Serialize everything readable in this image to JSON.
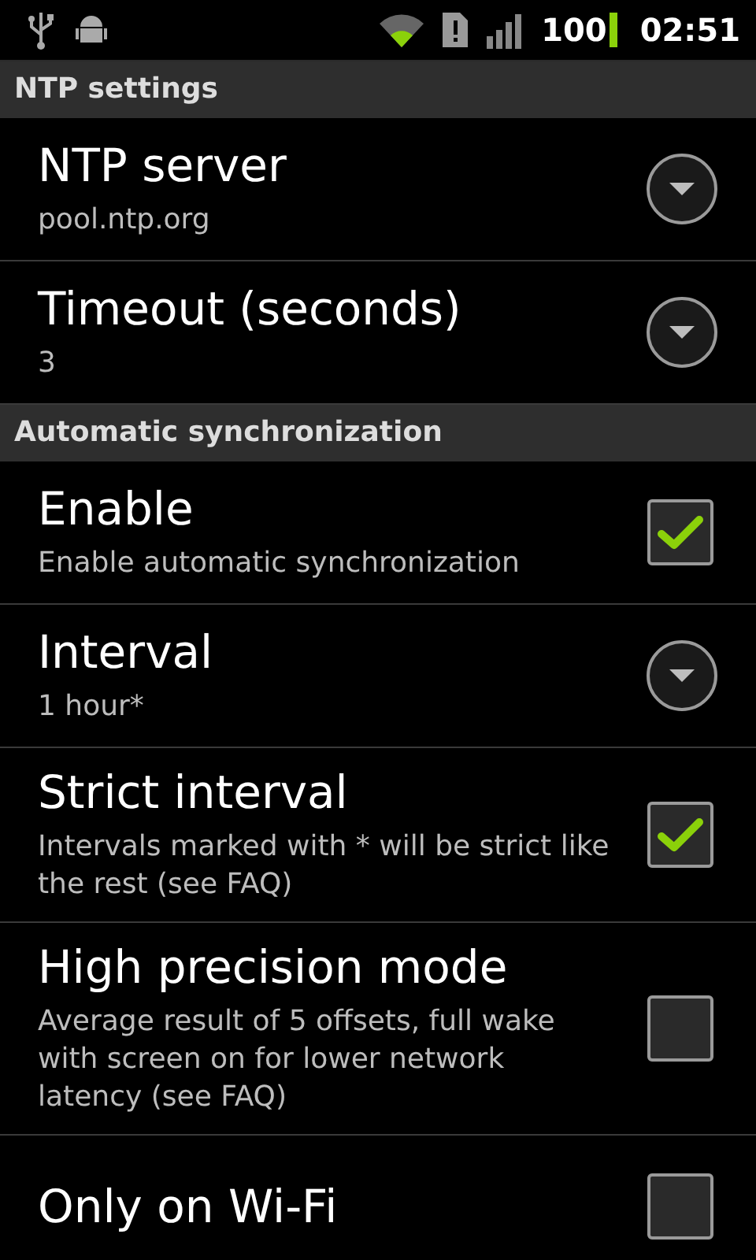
{
  "status_bar": {
    "battery": "100",
    "time": "02:51"
  },
  "sections": [
    {
      "title": "NTP settings",
      "items": [
        {
          "kind": "list",
          "title": "NTP server",
          "summary": "pool.ntp.org"
        },
        {
          "kind": "list",
          "title": "Timeout (seconds)",
          "summary": "3"
        }
      ]
    },
    {
      "title": "Automatic synchronization",
      "items": [
        {
          "kind": "checkbox",
          "title": "Enable",
          "summary": "Enable automatic synchronization",
          "checked": true
        },
        {
          "kind": "list",
          "title": "Interval",
          "summary": "1 hour*"
        },
        {
          "kind": "checkbox",
          "title": "Strict interval",
          "summary": "Intervals marked with * will be strict like the rest (see FAQ)",
          "checked": true
        },
        {
          "kind": "checkbox",
          "title": "High precision mode",
          "summary": "Average result of 5 offsets, full wake with screen on for lower network latency (see FAQ)",
          "checked": false
        },
        {
          "kind": "checkbox",
          "title": "Only on Wi-Fi",
          "checked": false
        }
      ]
    }
  ]
}
